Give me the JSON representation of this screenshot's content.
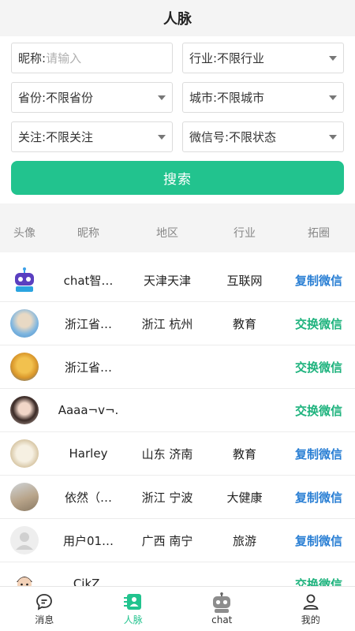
{
  "header": {
    "title": "人脉"
  },
  "filters": {
    "nickname_label": "昵称:",
    "nickname_placeholder": "请输入",
    "industry": "行业:不限行业",
    "province": "省份:不限省份",
    "city": "城市:不限城市",
    "follow": "关注:不限关注",
    "wechat": "微信号:不限状态",
    "search_label": "搜索"
  },
  "table": {
    "headers": [
      "头像",
      "昵称",
      "地区",
      "行业",
      "拓圈"
    ],
    "rows": [
      {
        "avatar": "robot-avatar",
        "nickname": "chat智…",
        "region": "天津天津",
        "industry": "互联网",
        "action": "复制微信",
        "action_type": "copy"
      },
      {
        "avatar": "photo-avatar",
        "nickname": "浙江省…",
        "region": "浙江 杭州",
        "industry": "教育",
        "action": "交换微信",
        "action_type": "exchange"
      },
      {
        "avatar": "photo-avatar",
        "nickname": "浙江省…",
        "region": "",
        "industry": "",
        "action": "交换微信",
        "action_type": "exchange"
      },
      {
        "avatar": "photo-avatar",
        "nickname": "Aaaa¬v¬.",
        "region": "",
        "industry": "",
        "action": "交换微信",
        "action_type": "exchange"
      },
      {
        "avatar": "photo-avatar",
        "nickname": "Harley",
        "region": "山东 济南",
        "industry": "教育",
        "action": "复制微信",
        "action_type": "copy"
      },
      {
        "avatar": "photo-avatar",
        "nickname": "依然（…",
        "region": "浙江 宁波",
        "industry": "大健康",
        "action": "复制微信",
        "action_type": "copy"
      },
      {
        "avatar": "default-user-avatar",
        "nickname": "用户01…",
        "region": "广西 南宁",
        "industry": "旅游",
        "action": "复制微信",
        "action_type": "copy"
      },
      {
        "avatar": "cartoon-avatar",
        "nickname": "CikZ.",
        "region": "",
        "industry": "",
        "action": "交换微信",
        "action_type": "exchange"
      }
    ]
  },
  "tabbar": {
    "items": [
      {
        "label": "消息",
        "icon": "message-icon"
      },
      {
        "label": "人脉",
        "icon": "contacts-icon"
      },
      {
        "label": "chat",
        "icon": "robot-icon"
      },
      {
        "label": "我的",
        "icon": "user-icon"
      }
    ]
  },
  "colors": {
    "accent": "#22c38e",
    "copy": "#2a7fd4",
    "exchange": "#1fb37e"
  }
}
